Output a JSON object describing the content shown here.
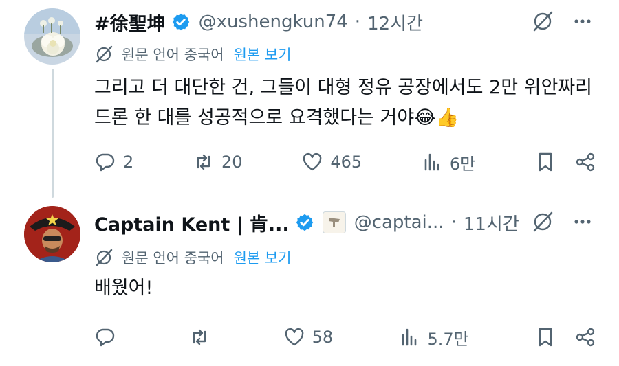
{
  "colors": {
    "accent": "#1d9bf0",
    "muted": "#536471",
    "text": "#0f1419"
  },
  "translate": {
    "label": "원문 언어 중국어",
    "show_original": "원본 보기"
  },
  "tweets": [
    {
      "name": "#徐聖坤",
      "handle": "@xushengkun74",
      "separator": "·",
      "time": "12시간",
      "text": "그리고 더 대단한 건, 그들이 대형 정유 공장에서도 2만 위안짜리 드론 한 대를 성공적으로 요격했다는 거야😂👍",
      "replies": "2",
      "reposts": "20",
      "likes": "465",
      "views": "6만"
    },
    {
      "name": "Captain Kent | 肯...",
      "handle": "@captai...",
      "separator": "·",
      "time": "11시간",
      "text": "배웠어!",
      "replies": "",
      "reposts": "",
      "likes": "58",
      "views": "5.7만"
    }
  ]
}
